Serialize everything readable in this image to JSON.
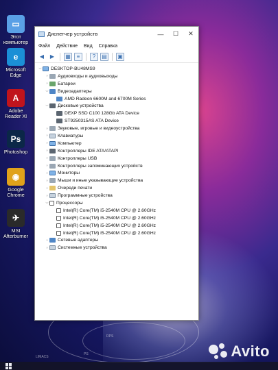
{
  "desktop": {
    "icons": [
      {
        "label": "Этот компьютер",
        "color": "#5aa0e6",
        "glyph": "▭"
      },
      {
        "label": "Microsoft Edge",
        "color": "#1b8fd6",
        "glyph": "e"
      },
      {
        "label": "Adobe Reader XI",
        "color": "#c0141c",
        "glyph": "A"
      },
      {
        "label": "Photoshop",
        "color": "#0b2748",
        "glyph": "Ps"
      },
      {
        "label": "Google Chrome",
        "color": "#e0a21a",
        "glyph": "◉"
      },
      {
        "label": "MSI Afterburner",
        "color": "#2a2a2a",
        "glyph": "✈"
      }
    ]
  },
  "window": {
    "title": "Диспетчер устройств",
    "menu": [
      "Файл",
      "Действие",
      "Вид",
      "Справка"
    ],
    "tree": [
      {
        "level": 0,
        "arrow": "⌵",
        "icon": "c-mon",
        "label": "DESKTOP-BU48MS9"
      },
      {
        "level": 1,
        "arrow": "›",
        "icon": "c-gray",
        "label": "Аудиовходы и аудиовыходы"
      },
      {
        "level": 1,
        "arrow": "›",
        "icon": "c-green",
        "label": "Батареи"
      },
      {
        "level": 1,
        "arrow": "⌵",
        "icon": "c-blue",
        "label": "Видеоадаптеры"
      },
      {
        "level": 2,
        "arrow": "",
        "icon": "c-blue",
        "label": "AMD Radeon 6600M and 6700M Series"
      },
      {
        "level": 1,
        "arrow": "⌵",
        "icon": "c-dark",
        "label": "Дисковые устройства"
      },
      {
        "level": 2,
        "arrow": "",
        "icon": "c-dark",
        "label": "DEXP SSD C100 128Gb ATA Device"
      },
      {
        "level": 2,
        "arrow": "",
        "icon": "c-dark",
        "label": "ST9250315AS ATA Device"
      },
      {
        "level": 1,
        "arrow": "›",
        "icon": "c-gray",
        "label": "Звуковые, игровые и видеоустройства"
      },
      {
        "level": 1,
        "arrow": "›",
        "icon": "c-lt",
        "label": "Клавиатуры"
      },
      {
        "level": 1,
        "arrow": "›",
        "icon": "c-mon",
        "label": "Компьютер"
      },
      {
        "level": 1,
        "arrow": "›",
        "icon": "c-dark",
        "label": "Контроллеры IDE ATA/ATAPI"
      },
      {
        "level": 1,
        "arrow": "›",
        "icon": "c-gray",
        "label": "Контроллеры USB"
      },
      {
        "level": 1,
        "arrow": "›",
        "icon": "c-gray",
        "label": "Контроллеры запоминающих устройств"
      },
      {
        "level": 1,
        "arrow": "›",
        "icon": "c-mon",
        "label": "Мониторы"
      },
      {
        "level": 1,
        "arrow": "›",
        "icon": "c-gray",
        "label": "Мыши и иные указывающие устройства"
      },
      {
        "level": 1,
        "arrow": "›",
        "icon": "c-yellow",
        "label": "Очереди печати"
      },
      {
        "level": 1,
        "arrow": "›",
        "icon": "c-lt",
        "label": "Программные устройства"
      },
      {
        "level": 1,
        "arrow": "⌵",
        "icon": "c-box",
        "label": "Процессоры"
      },
      {
        "level": 2,
        "arrow": "",
        "icon": "c-box",
        "label": "Intel(R) Core(TM) i5-2540M CPU @ 2.60GHz"
      },
      {
        "level": 2,
        "arrow": "",
        "icon": "c-box",
        "label": "Intel(R) Core(TM) i5-2540M CPU @ 2.60GHz"
      },
      {
        "level": 2,
        "arrow": "",
        "icon": "c-box",
        "label": "Intel(R) Core(TM) i5-2540M CPU @ 2.60GHz"
      },
      {
        "level": 2,
        "arrow": "",
        "icon": "c-box",
        "label": "Intel(R) Core(TM) i5-2540M CPU @ 2.60GHz"
      },
      {
        "level": 1,
        "arrow": "›",
        "icon": "c-blue",
        "label": "Сетевые адаптеры"
      },
      {
        "level": 1,
        "arrow": "›",
        "icon": "c-lt",
        "label": "Системные устройства"
      }
    ]
  },
  "wallpaper": {
    "labels": [
      "DPS",
      "LIMACS",
      "PS"
    ]
  },
  "watermark": {
    "text": "Avito"
  }
}
